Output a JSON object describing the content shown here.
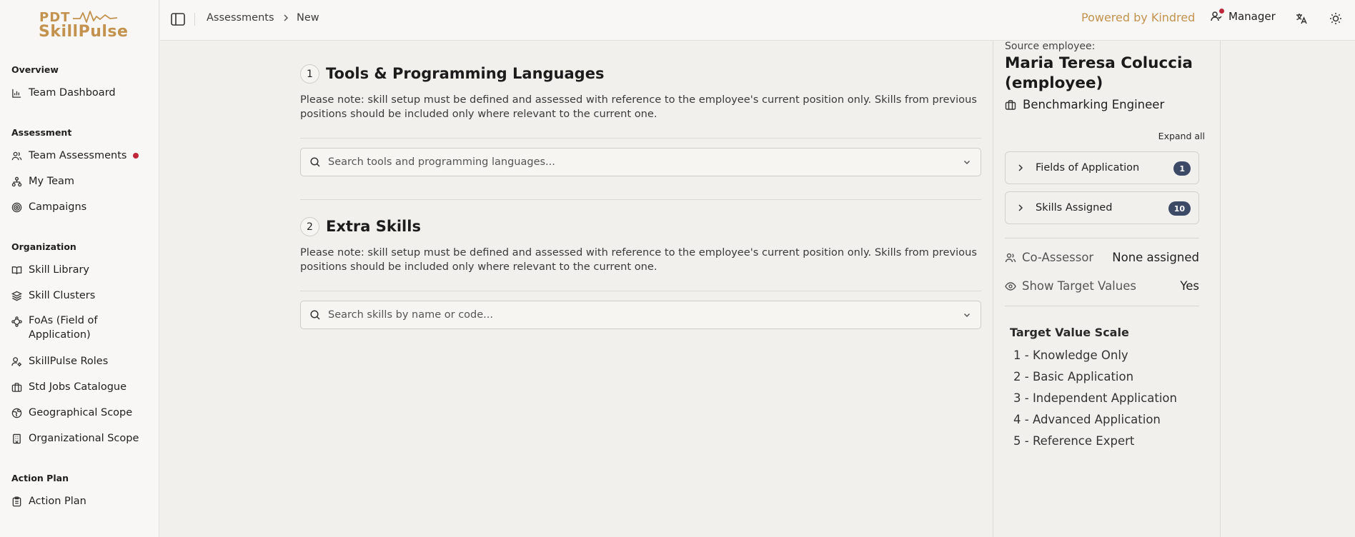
{
  "brand": {
    "line1": "PDT",
    "line2": "SkillPulse",
    "color": "#c3924e"
  },
  "sidebar": {
    "sections": [
      {
        "title": "Overview",
        "items": [
          {
            "label": "Team Dashboard",
            "icon": "bar-chart-icon"
          }
        ]
      },
      {
        "title": "Assessment",
        "items": [
          {
            "label": "Team Assessments",
            "icon": "users-icon",
            "dot": true
          },
          {
            "label": "My Team",
            "icon": "network-icon"
          },
          {
            "label": "Campaigns",
            "icon": "target-icon"
          }
        ]
      },
      {
        "title": "Organization",
        "items": [
          {
            "label": "Skill Library",
            "icon": "book-icon"
          },
          {
            "label": "Skill Clusters",
            "icon": "layers-icon"
          },
          {
            "label": "FoAs (Field of Application)",
            "icon": "waypoints-icon"
          },
          {
            "label": "SkillPulse Roles",
            "icon": "user-cog-icon"
          },
          {
            "label": "Std Jobs Catalogue",
            "icon": "briefcase-icon"
          },
          {
            "label": "Geographical Scope",
            "icon": "globe-icon"
          },
          {
            "label": "Organizational Scope",
            "icon": "building-icon"
          }
        ]
      },
      {
        "title": "Action Plan",
        "items": [
          {
            "label": "Action Plan",
            "icon": "clipboard-icon"
          }
        ]
      }
    ]
  },
  "topbar": {
    "breadcrumb": [
      "Assessments",
      "New"
    ],
    "powered_by": "Powered by Kindred",
    "role": "Manager"
  },
  "main": {
    "sections": [
      {
        "number": "1",
        "title": "Tools & Programming Languages",
        "note": "Please note: skill setup must be defined and assessed with reference to the employee's current position only. Skills from previous positions should be included only where relevant to the current one.",
        "search_placeholder": "Search tools and programming languages..."
      },
      {
        "number": "2",
        "title": "Extra Skills",
        "note": "Please note: skill setup must be defined and assessed with reference to the employee's current position only. Skills from previous positions should be included only where relevant to the current one.",
        "search_placeholder": "Search skills by name or code..."
      }
    ]
  },
  "panel": {
    "source_label": "Source employee:",
    "employee_name": "Maria Teresa Coluccia (employee)",
    "position": "Benchmarking Engineer",
    "expand_all": "Expand all",
    "accordions": [
      {
        "label": "Fields of Application",
        "count": "1"
      },
      {
        "label": "Skills Assigned",
        "count": "10"
      }
    ],
    "co_assessor": {
      "label": "Co-Assessor",
      "value": "None assigned"
    },
    "show_target": {
      "label": "Show Target Values",
      "value": "Yes"
    },
    "scale_title": "Target Value Scale",
    "scale": [
      "1 - Knowledge Only",
      "2 - Basic Application",
      "3 - Independent Application",
      "4 - Advanced Application",
      "5 - Reference Expert"
    ]
  }
}
